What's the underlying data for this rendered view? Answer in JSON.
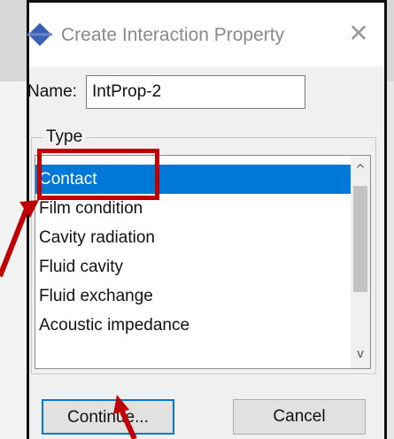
{
  "dialog": {
    "title": "Create Interaction Property",
    "close_glyph": "✕",
    "icon": "abaqus-interaction-icon"
  },
  "name_field": {
    "label": "Name:",
    "value": "IntProp-2"
  },
  "type_group": {
    "title": "Type",
    "items": [
      {
        "label": "Contact",
        "selected": true
      },
      {
        "label": "Film condition"
      },
      {
        "label": "Cavity radiation"
      },
      {
        "label": "Fluid cavity"
      },
      {
        "label": "Fluid exchange"
      },
      {
        "label": "Acoustic impedance"
      }
    ]
  },
  "buttons": {
    "continue_label": "Continue...",
    "cancel_label": "Cancel"
  },
  "scrollbar": {
    "up_glyph": "^",
    "down_glyph": "v"
  },
  "annotation_color": "#c00000",
  "selection_color": "#0078d7"
}
